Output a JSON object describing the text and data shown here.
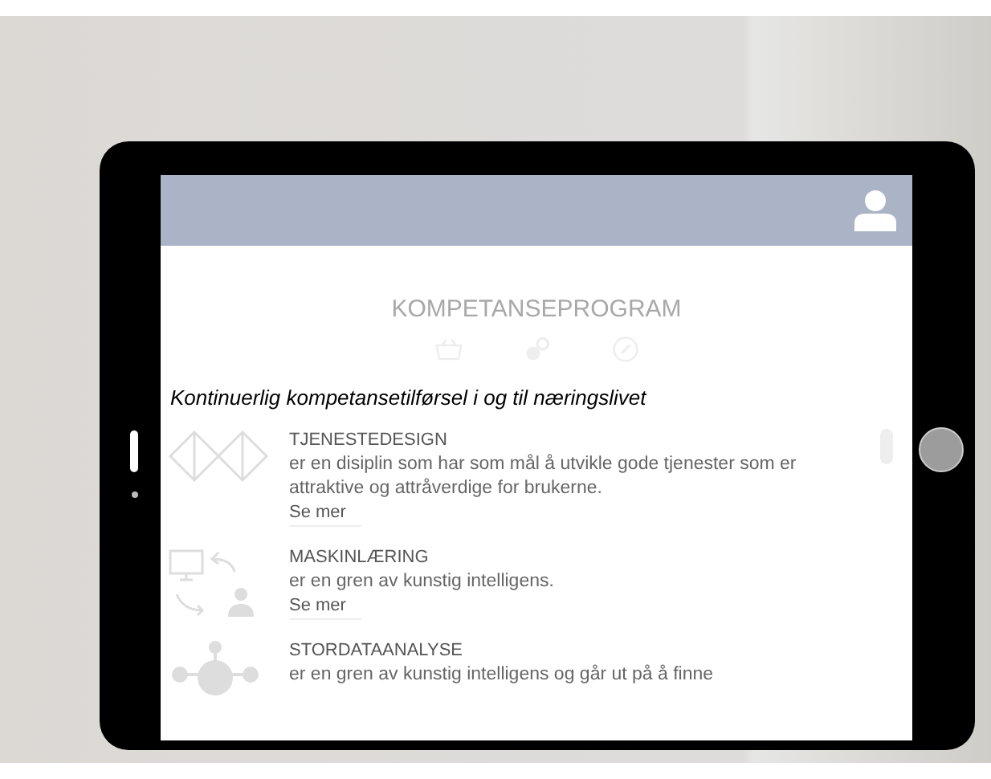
{
  "app": {
    "title": "KOMPETANSEPROGRAM",
    "tagline": "Kontinuerlig kompetansetilførsel i og til næringslivet"
  },
  "programs": [
    {
      "kind": "design",
      "title": "TJENESTEDESIGN",
      "description": "er en disiplin som har som mål å utvikle gode tjenester som er attraktive og attråverdige for brukerne.",
      "link": "Se mer"
    },
    {
      "kind": "ml",
      "title": "MASKINLÆRING",
      "description": "er en gren av kunstig intelligens.",
      "link": "Se mer"
    },
    {
      "kind": "data",
      "title": "STORDATAANALYSE",
      "description": "er en gren av kunstig intelligens og går ut på å finne"
    }
  ]
}
